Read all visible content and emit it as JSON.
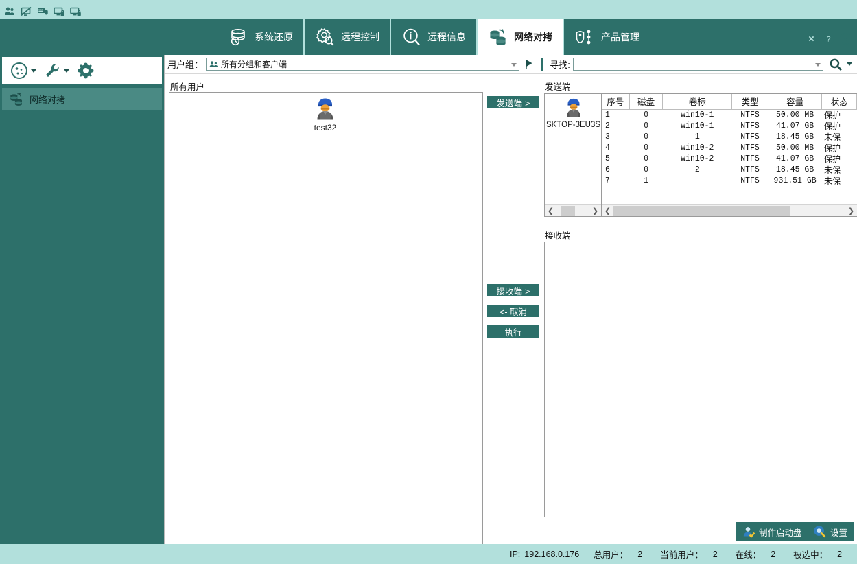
{
  "window": {
    "mini_toolbar": [
      "users-icon",
      "screen-disabled-icon",
      "keyboard-mouse-icon",
      "monitor-lock-icon",
      "monitor-lock-alt-icon"
    ],
    "controls": [
      {
        "name": "close-icon",
        "glyph": "✕"
      },
      {
        "name": "help-icon",
        "glyph": "?"
      },
      {
        "name": "copyright-icon",
        "glyph": "©"
      }
    ]
  },
  "tabs": [
    {
      "label": "系统还原",
      "icon": "database-restore-icon",
      "active": false
    },
    {
      "label": "远程控制",
      "icon": "gear-search-icon",
      "active": false
    },
    {
      "label": "远程信息",
      "icon": "info-search-icon",
      "active": false
    },
    {
      "label": "网络对拷",
      "icon": "database-copy-icon",
      "active": true
    },
    {
      "label": "产品管理",
      "icon": "product-tree-icon",
      "active": false
    }
  ],
  "sidebar": {
    "tools": [
      {
        "name": "face-icon",
        "has_caret": true
      },
      {
        "name": "wrench-icon",
        "has_caret": true
      },
      {
        "name": "gear-icon",
        "has_caret": false
      }
    ],
    "items": [
      {
        "label": "网络对拷",
        "icon": "database-copy-icon",
        "selected": true
      }
    ]
  },
  "filter": {
    "usergroup_label": "用户组：",
    "usergroup_value": "所有分组和客户端",
    "search_label": "寻找:",
    "search_value": "",
    "search_placeholder": "",
    "search_button": "search-icon"
  },
  "main": {
    "user_list_caption": "所有用户",
    "users": [
      {
        "name": "test32",
        "icon": "user-avatar-icon"
      }
    ],
    "buttons": [
      {
        "label": "发送端->",
        "name": "send-end-button"
      },
      {
        "label": "接收端->",
        "name": "receive-end-button"
      },
      {
        "label": "<- 取消",
        "name": "cancel-button"
      },
      {
        "label": "执行",
        "name": "execute-button"
      }
    ],
    "sender": {
      "caption": "发送端",
      "node_name": "SKTOP-3EU3S",
      "columns": [
        "序号",
        "磁盘",
        "卷标",
        "类型",
        "容量",
        "状态"
      ],
      "rows": [
        {
          "seq": "1",
          "disk": "0",
          "volume": "win10-1",
          "type": "NTFS",
          "capacity": "50.00 MB",
          "status": "保护"
        },
        {
          "seq": "2",
          "disk": "0",
          "volume": "win10-1",
          "type": "NTFS",
          "capacity": "41.07 GB",
          "status": "保护"
        },
        {
          "seq": "3",
          "disk": "0",
          "volume": "1",
          "type": "NTFS",
          "capacity": "18.45 GB",
          "status": "未保"
        },
        {
          "seq": "4",
          "disk": "0",
          "volume": "win10-2",
          "type": "NTFS",
          "capacity": "50.00 MB",
          "status": "保护"
        },
        {
          "seq": "5",
          "disk": "0",
          "volume": "win10-2",
          "type": "NTFS",
          "capacity": "41.07 GB",
          "status": "保护"
        },
        {
          "seq": "6",
          "disk": "0",
          "volume": "2",
          "type": "NTFS",
          "capacity": "18.45 GB",
          "status": "未保"
        },
        {
          "seq": "7",
          "disk": "1",
          "volume": "",
          "type": "NTFS",
          "capacity": "931.51 GB",
          "status": "未保"
        }
      ]
    },
    "receiver": {
      "caption": "接收端",
      "rows": []
    },
    "bottom_buttons": [
      {
        "label": "制作启动盘",
        "icon": "boot-disk-icon",
        "name": "make-boot-disk-button"
      },
      {
        "label": "设置",
        "icon": "settings-search-icon",
        "name": "settings-button"
      }
    ]
  },
  "status": {
    "ip_label": "IP:",
    "ip_value": "192.168.0.176",
    "metrics": [
      {
        "key": "总用户：",
        "value": "2"
      },
      {
        "key": "当前用户：",
        "value": "2"
      },
      {
        "key": "在线：",
        "value": "2"
      },
      {
        "key": "被选中：",
        "value": "2"
      }
    ]
  },
  "colors": {
    "teal_dark": "#2d706a",
    "teal_light": "#b2e0dc",
    "teal_mid": "#4a8a84",
    "text": "#111111"
  }
}
